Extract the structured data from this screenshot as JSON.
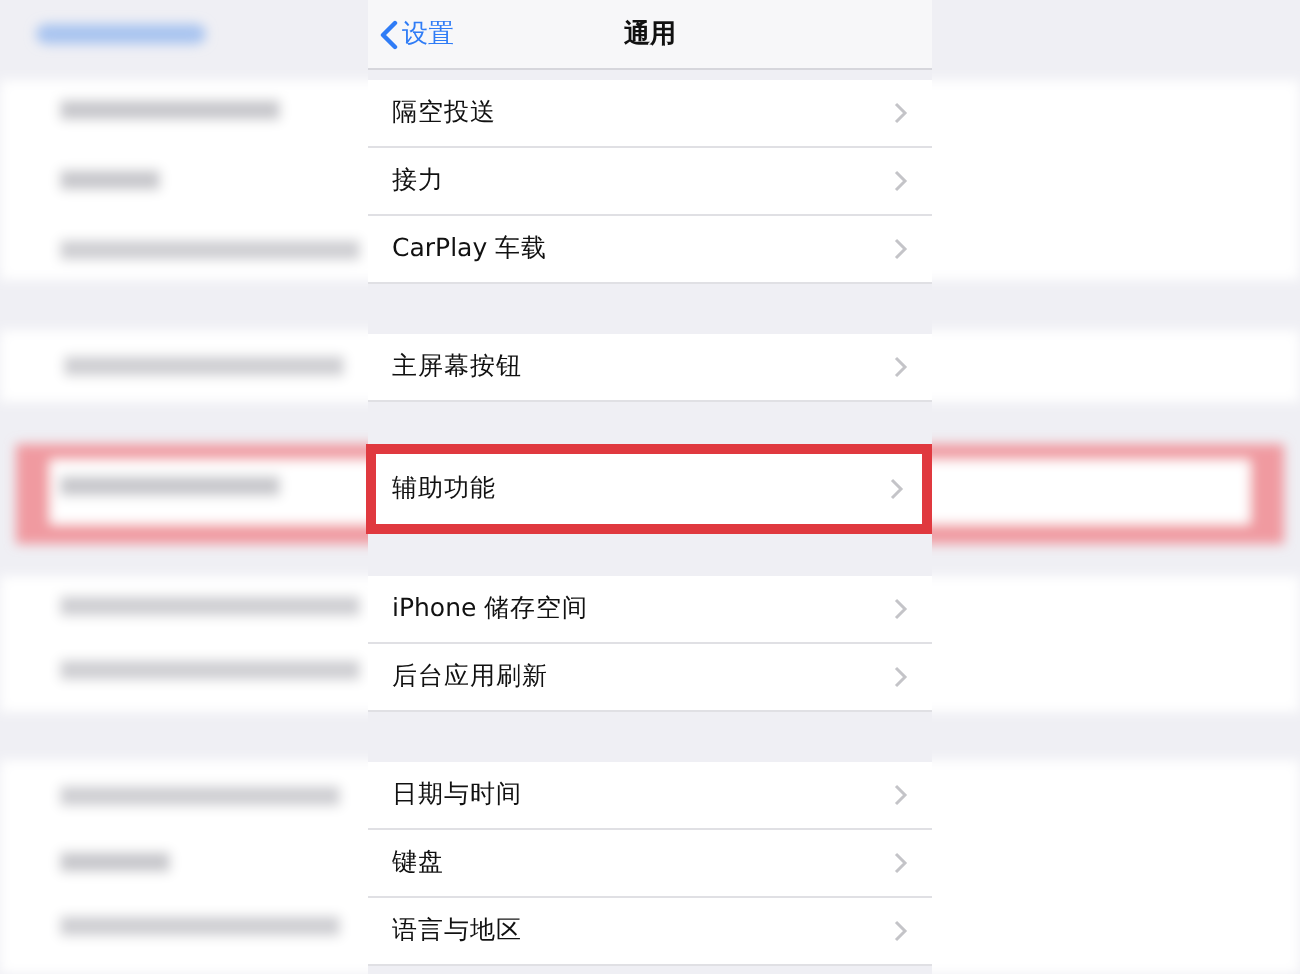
{
  "nav": {
    "back": "设置",
    "title": "通用"
  },
  "groups": [
    {
      "rows": [
        {
          "label": "隔空投送",
          "highlighted": false
        },
        {
          "label": "接力",
          "highlighted": false
        },
        {
          "label": "CarPlay 车载",
          "highlighted": false
        }
      ]
    },
    {
      "rows": [
        {
          "label": "主屏幕按钮",
          "highlighted": false
        }
      ]
    },
    {
      "rows": [
        {
          "label": "辅助功能",
          "highlighted": true
        }
      ]
    },
    {
      "rows": [
        {
          "label": "iPhone 储存空间",
          "highlighted": false
        },
        {
          "label": "后台应用刷新",
          "highlighted": false
        }
      ]
    },
    {
      "rows": [
        {
          "label": "日期与时间",
          "highlighted": false
        },
        {
          "label": "键盘",
          "highlighted": false
        },
        {
          "label": "语言与地区",
          "highlighted": false
        }
      ]
    }
  ]
}
